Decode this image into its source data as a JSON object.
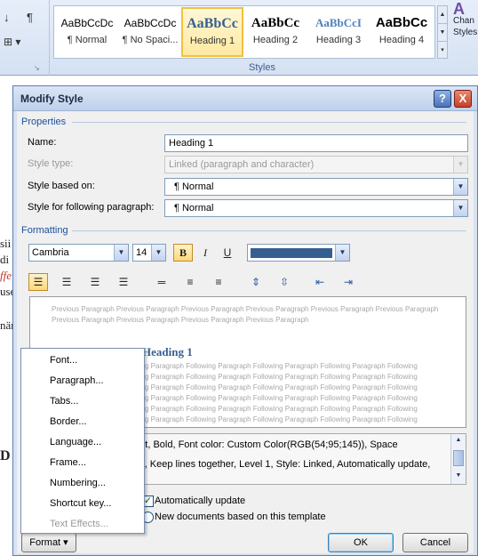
{
  "ribbon": {
    "styles": [
      {
        "sample": "AaBbCcDc",
        "name": "¶ Normal"
      },
      {
        "sample": "AaBbCcDc",
        "name": "¶ No Spaci..."
      },
      {
        "sample": "AaBbCc",
        "name": "Heading 1"
      },
      {
        "sample": "AaBbCc",
        "name": "Heading 2"
      },
      {
        "sample": "AaBbCcI",
        "name": "Heading 3"
      },
      {
        "sample": "AaBbCc",
        "name": "Heading 4"
      }
    ],
    "group_label": "Styles",
    "change_styles": {
      "line1": "Chan",
      "line2": "Styles"
    }
  },
  "dialog": {
    "title": "Modify Style",
    "help": "?",
    "close": "X",
    "properties": {
      "section": "Properties",
      "name_label": "Name:",
      "name_value": "Heading 1",
      "style_type_label": "Style type:",
      "style_type_value": "Linked (paragraph and character)",
      "based_on_label": "Style based on:",
      "based_on_value": "¶  Normal",
      "following_label": "Style for following paragraph:",
      "following_value": "¶  Normal"
    },
    "formatting": {
      "section": "Formatting",
      "font": "Cambria",
      "size": "14",
      "bold": "B",
      "italic": "I",
      "underline": "U",
      "font_color": "#365f91"
    },
    "preview": {
      "previous_1": "Previous Paragraph Previous Paragraph Previous Paragraph Previous Paragraph Previous Paragraph Previous Paragraph",
      "previous_2": "Previous Paragraph Previous Paragraph Previous Paragraph Previous Paragraph",
      "heading": "Heading 1",
      "following": "Following Paragraph Following Paragraph Following Paragraph Following Paragraph Following Paragraph Following"
    },
    "description": {
      "line1": "4 pt, Bold, Font color: Custom Color(RGB(54;95;145)), Space",
      "line2": "ext, Keep lines together, Level 1, Style: Linked, Automatically update,"
    },
    "options": {
      "auto_update": "Automatically update",
      "new_docs": "New documents based on this template"
    },
    "buttons": {
      "format": "Format ▾",
      "ok": "OK",
      "cancel": "Cancel"
    }
  },
  "format_menu": [
    {
      "label": "Font...",
      "enabled": true
    },
    {
      "label": "Paragraph...",
      "enabled": true
    },
    {
      "label": "Tabs...",
      "enabled": true
    },
    {
      "label": "Border...",
      "enabled": true
    },
    {
      "label": "Language...",
      "enabled": true
    },
    {
      "label": "Frame...",
      "enabled": true
    },
    {
      "label": "Numbering...",
      "enabled": true
    },
    {
      "label": "Shortcut key...",
      "enabled": true
    },
    {
      "label": "Text Effects...",
      "enabled": false
    }
  ],
  "document": {
    "fragments": [
      "sii",
      "di",
      "ffe",
      "use",
      "när",
      "D"
    ]
  }
}
